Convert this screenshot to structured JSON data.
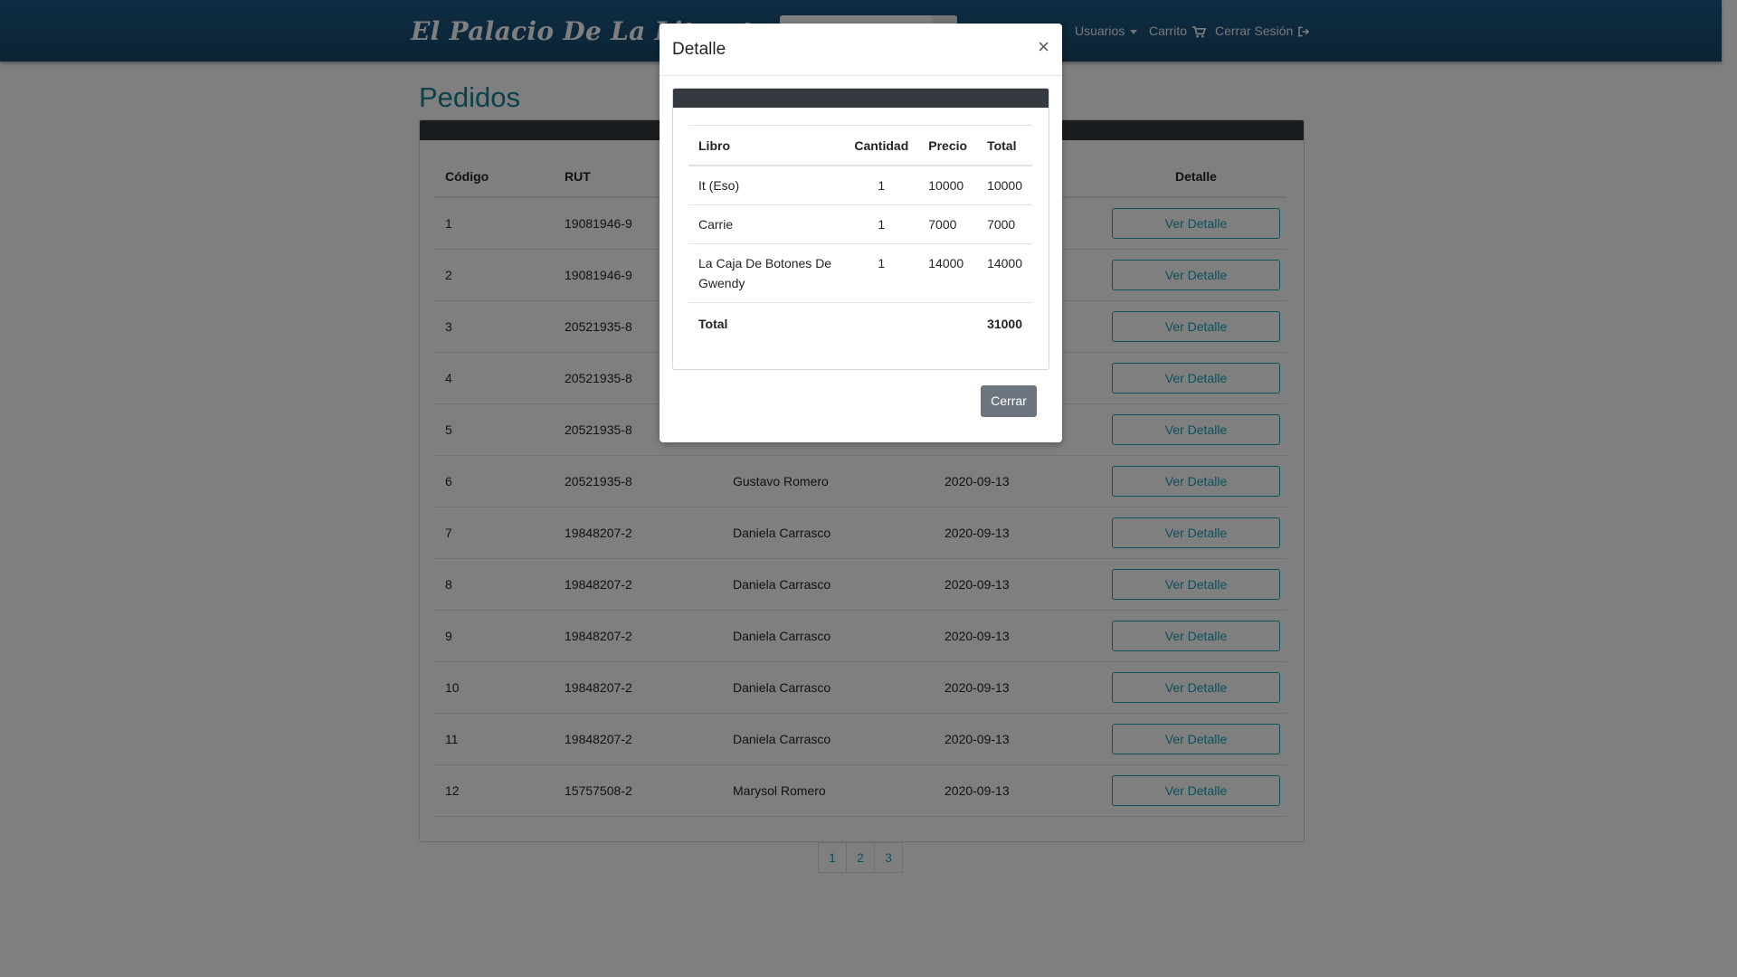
{
  "navbar": {
    "brand": "El Palacio De La Literatura",
    "usuarios": "Usuarios",
    "carrito": "Carrito",
    "logout": "Cerrar Sesión"
  },
  "page": {
    "title": "Pedidos"
  },
  "orders": {
    "headers": {
      "codigo": "Código",
      "rut": "RUT",
      "cliente": "",
      "fecha": "",
      "detalle": "Detalle"
    },
    "button_label": "Ver Detalle",
    "rows": [
      {
        "codigo": "1",
        "rut": "19081946-9",
        "cliente": "",
        "fecha": ""
      },
      {
        "codigo": "2",
        "rut": "19081946-9",
        "cliente": "",
        "fecha": ""
      },
      {
        "codigo": "3",
        "rut": "20521935-8",
        "cliente": "",
        "fecha": ""
      },
      {
        "codigo": "4",
        "rut": "20521935-8",
        "cliente": "",
        "fecha": ""
      },
      {
        "codigo": "5",
        "rut": "20521935-8",
        "cliente": "",
        "fecha": ""
      },
      {
        "codigo": "6",
        "rut": "20521935-8",
        "cliente": "Gustavo Romero",
        "fecha": "2020-09-13"
      },
      {
        "codigo": "7",
        "rut": "19848207-2",
        "cliente": "Daniela Carrasco",
        "fecha": "2020-09-13"
      },
      {
        "codigo": "8",
        "rut": "19848207-2",
        "cliente": "Daniela Carrasco",
        "fecha": "2020-09-13"
      },
      {
        "codigo": "9",
        "rut": "19848207-2",
        "cliente": "Daniela Carrasco",
        "fecha": "2020-09-13"
      },
      {
        "codigo": "10",
        "rut": "19848207-2",
        "cliente": "Daniela Carrasco",
        "fecha": "2020-09-13"
      },
      {
        "codigo": "11",
        "rut": "19848207-2",
        "cliente": "Daniela Carrasco",
        "fecha": "2020-09-13"
      },
      {
        "codigo": "12",
        "rut": "15757508-2",
        "cliente": "Marysol Romero",
        "fecha": "2020-09-13"
      }
    ]
  },
  "pagination": {
    "pages": [
      "1",
      "2",
      "3"
    ]
  },
  "modal": {
    "title": "Detalle",
    "close_symbol": "×",
    "headers": {
      "libro": "Libro",
      "cantidad": "Cantidad",
      "precio": "Precio",
      "total": "Total"
    },
    "items": [
      {
        "libro": "It (Eso)",
        "cantidad": "1",
        "precio": "10000",
        "total": "10000"
      },
      {
        "libro": "Carrie",
        "cantidad": "1",
        "precio": "7000",
        "total": "7000"
      },
      {
        "libro": "La Caja De Botones De Gwendy",
        "cantidad": "1",
        "precio": "14000",
        "total": "14000"
      }
    ],
    "total_label": "Total",
    "total_value": "31000",
    "close_button": "Cerrar"
  },
  "colors": {
    "accent": "#17a2b8",
    "title": "#138496",
    "dark": "#343a40",
    "navbar": "#1a5077"
  }
}
